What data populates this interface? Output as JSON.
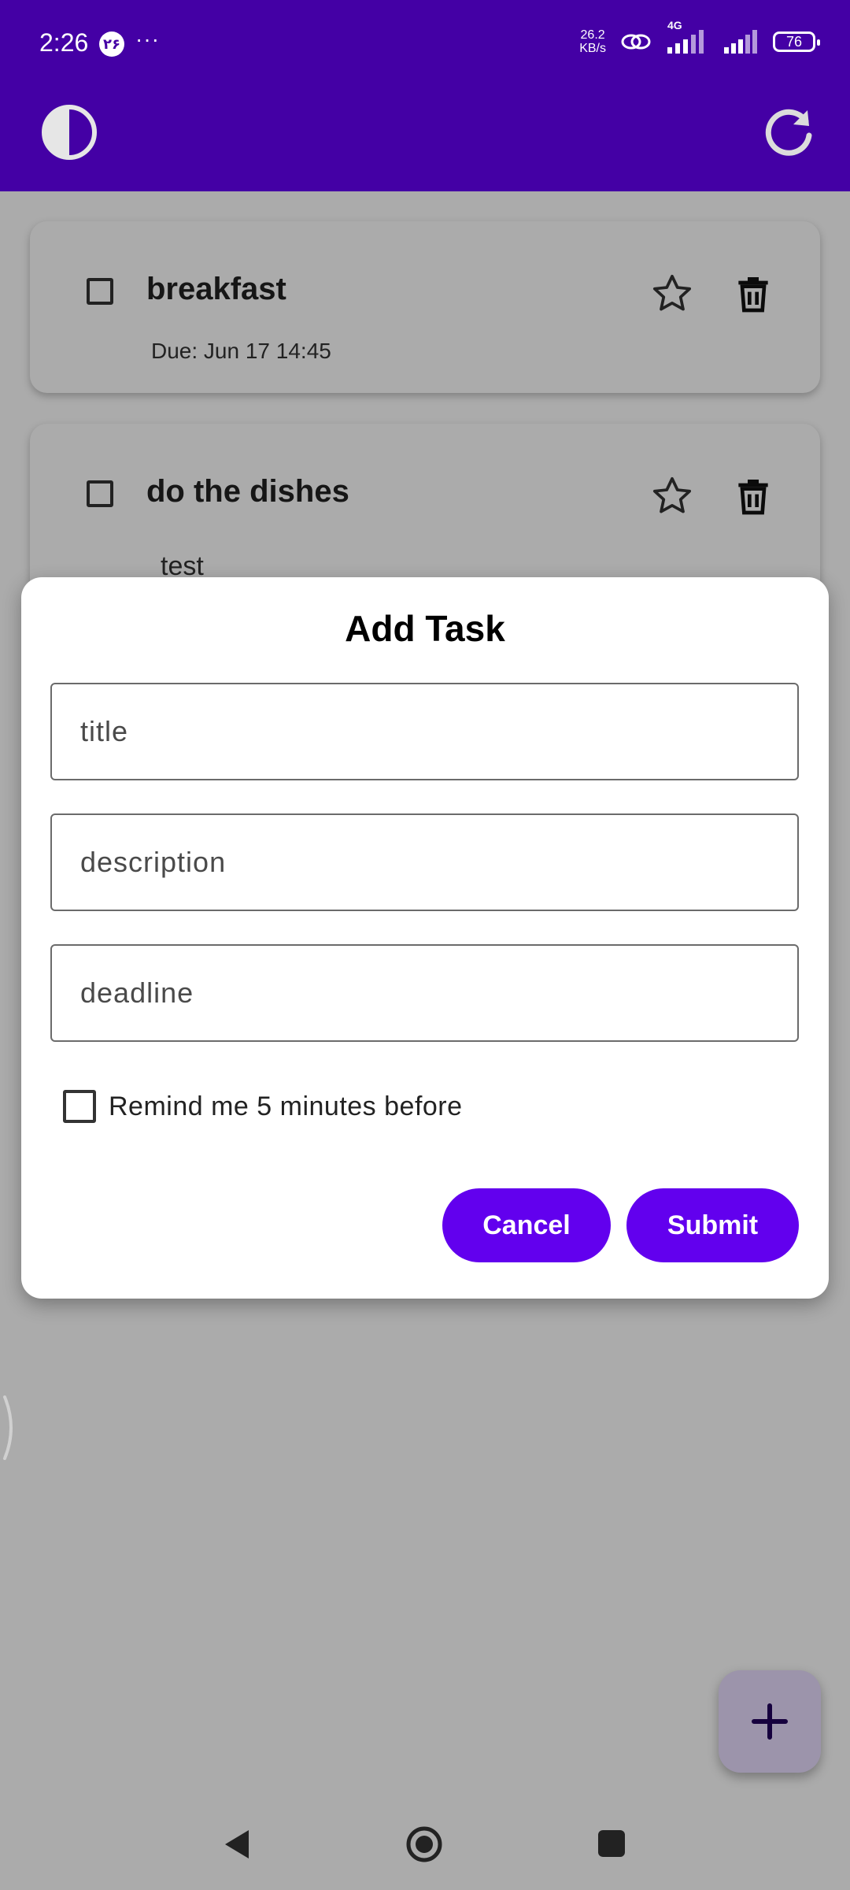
{
  "status_bar": {
    "time": "2:26",
    "notification_badge": "۲۶",
    "more_indicator": "···",
    "net_speed_value": "26.2",
    "net_speed_unit": "KB/s",
    "network_type": "4G",
    "battery": "76"
  },
  "app_bar": {
    "background": "#4400a5",
    "left_icon": "theme-toggle-icon",
    "right_icon": "refresh-icon"
  },
  "tasks": [
    {
      "title": "breakfast",
      "subtitle": "Due: Jun 17 14:45",
      "star_icon": "star-outline-icon",
      "delete_icon": "trash-icon"
    },
    {
      "title": "do the dishes",
      "subtitle": "test",
      "star_icon": "star-outline-icon",
      "delete_icon": "trash-icon"
    }
  ],
  "dialog": {
    "title": "Add Task",
    "fields": [
      {
        "placeholder": "title",
        "value": ""
      },
      {
        "placeholder": "description",
        "value": ""
      },
      {
        "placeholder": "deadline",
        "value": ""
      }
    ],
    "reminder": {
      "label": "Remind me 5 minutes before",
      "checked": false
    },
    "cancel_label": "Cancel",
    "submit_label": "Submit",
    "button_color": "#6200ee"
  },
  "fab": {
    "icon": "plus-icon"
  },
  "nav_bar": {
    "back_icon": "back-icon",
    "home_icon": "home-icon",
    "recents_icon": "recents-icon"
  }
}
